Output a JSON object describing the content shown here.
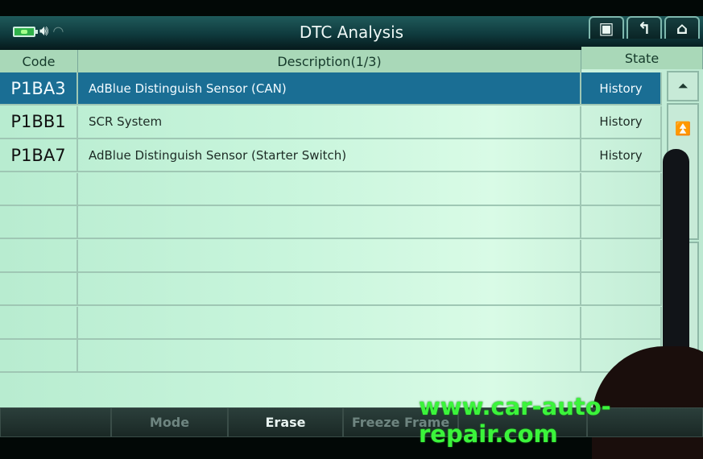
{
  "header": {
    "title": "DTC Analysis",
    "status_icons": [
      "battery-icon",
      "speaker-icon",
      "wifi-icon"
    ],
    "nav_buttons": [
      {
        "name": "screenshot-button",
        "icon": "camera-icon",
        "glyph": "▣"
      },
      {
        "name": "back-button",
        "icon": "return-arrow-icon",
        "glyph": "↰"
      },
      {
        "name": "home-button",
        "icon": "home-icon",
        "glyph": "⌂"
      }
    ]
  },
  "table": {
    "columns": {
      "code": "Code",
      "description": "Description(1/3)",
      "state": "State"
    },
    "rows": [
      {
        "code": "P1BA3",
        "description": "AdBlue Distinguish Sensor (CAN)",
        "state": "History",
        "selected": true
      },
      {
        "code": "P1BB1",
        "description": "SCR System",
        "state": "History",
        "selected": false
      },
      {
        "code": "P1BA7",
        "description": "AdBlue Distinguish Sensor (Starter Switch)",
        "state": "History",
        "selected": false
      },
      {
        "code": "",
        "description": "",
        "state": "",
        "selected": false
      },
      {
        "code": "",
        "description": "",
        "state": "",
        "selected": false
      },
      {
        "code": "",
        "description": "",
        "state": "",
        "selected": false
      },
      {
        "code": "",
        "description": "",
        "state": "",
        "selected": false
      },
      {
        "code": "",
        "description": "",
        "state": "",
        "selected": false
      },
      {
        "code": "",
        "description": "",
        "state": "",
        "selected": false
      }
    ],
    "scroll": {
      "top_glyph": "⏶",
      "page_up_glyph": "⏫"
    }
  },
  "footer": {
    "buttons": [
      "",
      "Mode",
      "Erase",
      "Freeze Frame",
      "",
      ""
    ],
    "active": "Erase"
  },
  "watermark": "www.car-auto-repair.com",
  "colors": {
    "selected_row": "#1a6e94",
    "header_bar": "#0f3a3d",
    "watermark": "#3bf43b"
  }
}
